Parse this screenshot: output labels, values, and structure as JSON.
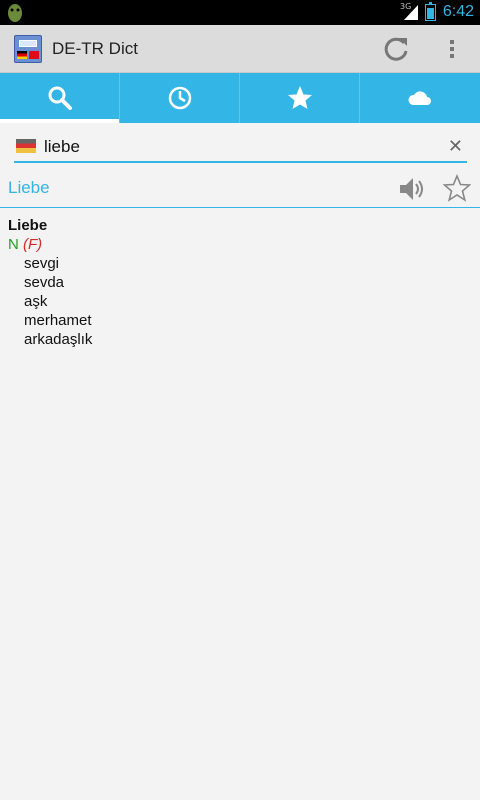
{
  "status_bar": {
    "network": "3G",
    "time": "6:42",
    "accent": "#33b5e5"
  },
  "action_bar": {
    "title": "DE-TR Dict",
    "icons": [
      "app-icon",
      "refresh-icon",
      "overflow-menu-icon"
    ]
  },
  "tabs": [
    {
      "icon": "search-icon",
      "selected": true
    },
    {
      "icon": "history-clock-icon",
      "selected": false
    },
    {
      "icon": "favorites-star-icon",
      "selected": false
    },
    {
      "icon": "cloud-icon",
      "selected": false
    }
  ],
  "search": {
    "value": "liebe",
    "source_language_flag": "german-flag-icon"
  },
  "result": {
    "headword": "Liebe",
    "entry": {
      "headword": "Liebe",
      "part_of_speech": "N",
      "gender": "(F)",
      "translations": [
        "sevgi",
        "sevda",
        "aşk",
        "merhamet",
        "arkadaşlık"
      ]
    }
  },
  "colors": {
    "accent": "#33b5e5",
    "pos": "#2a9a2a",
    "gender": "#d42a2a"
  }
}
